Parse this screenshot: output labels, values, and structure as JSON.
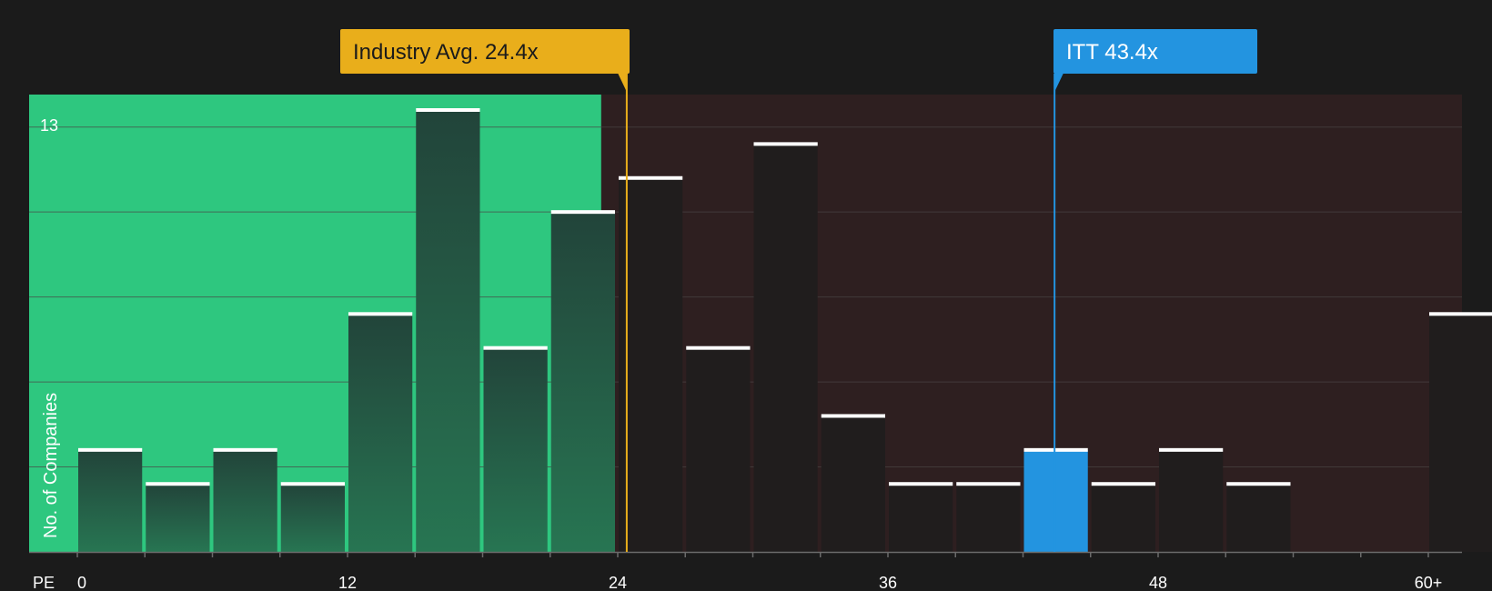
{
  "chart_data": {
    "type": "bar",
    "x_axis_label": "PE",
    "y_axis_label": "No. of Companies",
    "y_max_label": "13",
    "ylim": [
      0,
      13.5
    ],
    "x_ticks": [
      {
        "value": 0,
        "label": "0"
      },
      {
        "value": 12,
        "label": "12"
      },
      {
        "value": 24,
        "label": "24"
      },
      {
        "value": 36,
        "label": "36"
      },
      {
        "value": 48,
        "label": "48"
      },
      {
        "value": 60,
        "label": "60+"
      }
    ],
    "bin_width": 3,
    "bins": [
      {
        "start": 0,
        "count": 3
      },
      {
        "start": 3,
        "count": 2
      },
      {
        "start": 6,
        "count": 3
      },
      {
        "start": 9,
        "count": 2
      },
      {
        "start": 12,
        "count": 7
      },
      {
        "start": 15,
        "count": 13
      },
      {
        "start": 18,
        "count": 6
      },
      {
        "start": 21,
        "count": 10
      },
      {
        "start": 24,
        "count": 11
      },
      {
        "start": 27,
        "count": 6
      },
      {
        "start": 30,
        "count": 12
      },
      {
        "start": 33,
        "count": 4
      },
      {
        "start": 36,
        "count": 2
      },
      {
        "start": 39,
        "count": 2
      },
      {
        "start": 42,
        "count": 3
      },
      {
        "start": 45,
        "count": 2
      },
      {
        "start": 48,
        "count": 3
      },
      {
        "start": 51,
        "count": 2
      },
      {
        "start": 54,
        "count": 0
      },
      {
        "start": 57,
        "count": 0
      },
      {
        "start": 60,
        "count": 7
      }
    ],
    "industry_avg": {
      "value": 24.4,
      "label": "Industry Avg. 24.4x",
      "color": "#e9ae1b"
    },
    "company": {
      "value": 43.4,
      "label": "ITT 43.4x",
      "color": "#2394e0"
    },
    "colors": {
      "background": "#1b1b1b",
      "good_zone": "#2ec77f",
      "bad_zone": "#2e1f20",
      "bar_good_top": "#22443a",
      "bar_good_bottom": "#277552",
      "bar_bad": "#201d1d",
      "bar_cap": "#ffffff",
      "highlight_bar": "#2394e0",
      "grid": "#4a4444"
    }
  }
}
